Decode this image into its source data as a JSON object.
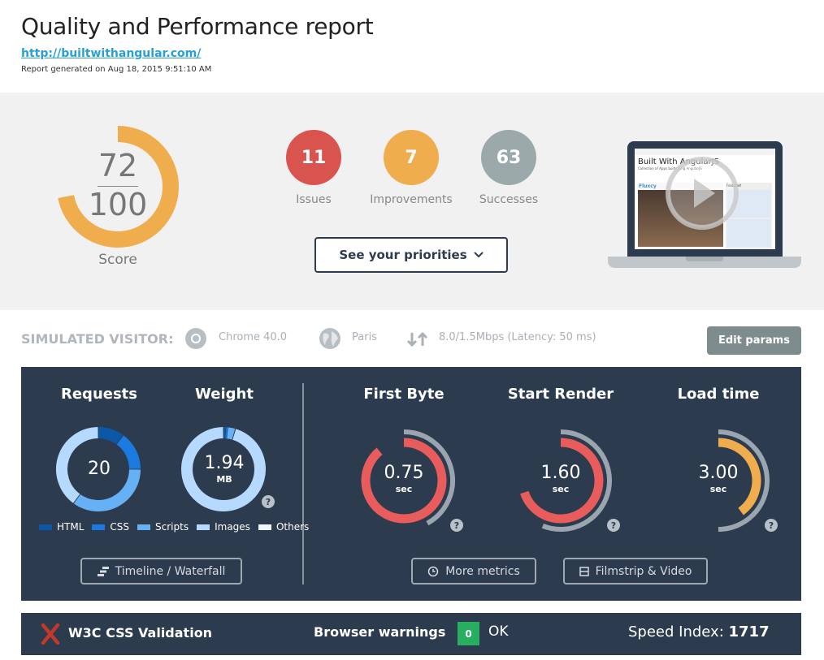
{
  "header": {
    "title": "Quality and Performance report",
    "url": "http://builtwithangular.com/",
    "generated": "Report generated on Aug 18, 2015 9:51:10 AM"
  },
  "score": {
    "value": "72",
    "max": "100",
    "label": "Score",
    "percent": 72,
    "color": "#f0ad4e"
  },
  "counts": [
    {
      "value": "11",
      "label": "Issues",
      "color": "#d9534f"
    },
    {
      "value": "7",
      "label": "Improvements",
      "color": "#f0ad4e"
    },
    {
      "value": "63",
      "label": "Successes",
      "color": "#9ba9ab"
    }
  ],
  "priorities_button": "See your priorities",
  "preview": {
    "site_title": "Built With AngularJS",
    "site_sub": "Collection of Apps built using AngularJS",
    "featured": "Fluxcy",
    "side_label": "Featured",
    "icons": [
      "play-icon"
    ]
  },
  "visitor": {
    "label": "SIMULATED VISITOR:",
    "browser": "Chrome 40.0",
    "location": "Paris",
    "bandwidth": "8.0/1.5Mbps (Latency: 50 ms)",
    "edit": "Edit params"
  },
  "requests": {
    "title": "Requests",
    "value": "20",
    "breakdown": [
      {
        "type": "HTML",
        "count": 2
      },
      {
        "type": "CSS",
        "count": 3
      },
      {
        "type": "Scripts",
        "count": 7
      },
      {
        "type": "Images",
        "count": 8
      }
    ]
  },
  "weight": {
    "title": "Weight",
    "value": "1.94",
    "unit": "MB",
    "breakdown_percent": [
      {
        "type": "HTML",
        "value": 1
      },
      {
        "type": "CSS",
        "value": 0.6
      },
      {
        "type": "Scripts",
        "value": 3
      },
      {
        "type": "Images",
        "value": 95.4
      }
    ]
  },
  "legend": [
    {
      "label": "HTML",
      "color": "#0d58a6"
    },
    {
      "label": "CSS",
      "color": "#1a7ae0"
    },
    {
      "label": "Scripts",
      "color": "#66b0f5"
    },
    {
      "label": "Images",
      "color": "#b5d9ff"
    },
    {
      "label": "Others",
      "color": "#eef6ff"
    }
  ],
  "timeline_button": "Timeline / Waterfall",
  "timings": [
    {
      "title": "First Byte",
      "value": "0.75",
      "unit": "sec",
      "fraction": 0.89,
      "reference_fraction": 0.42,
      "color": "#e85c5c"
    },
    {
      "title": "Start Render",
      "value": "1.60",
      "unit": "sec",
      "fraction": 0.7,
      "reference_fraction": 0.56,
      "color": "#e85c5c"
    },
    {
      "title": "Load time",
      "value": "3.00",
      "unit": "sec",
      "fraction": 0.4,
      "reference_fraction": 0.5,
      "color": "#f0ad4e"
    }
  ],
  "more_metrics": "More metrics",
  "filmstrip": "Filmstrip & Video",
  "footer": {
    "w3c": "W3C CSS Validation",
    "warnings_label": "Browser warnings",
    "warnings_count": "0",
    "warnings_status": "OK",
    "speed_label": "Speed Index:",
    "speed_value": "1717"
  }
}
